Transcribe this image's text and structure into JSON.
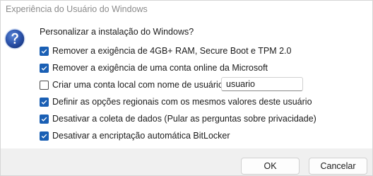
{
  "window": {
    "title": "Experiência do Usuário do Windows"
  },
  "dialog": {
    "prompt": "Personalizar a instalação do Windows?",
    "icon": "question-icon",
    "options": [
      {
        "label": "Remover a exigência de 4GB+ RAM, Secure Boot e TPM 2.0",
        "checked": true
      },
      {
        "label": "Remover a exigência de uma conta online da Microsoft",
        "checked": true
      },
      {
        "label": "Criar uma conta local com nome de usuário:",
        "checked": false
      },
      {
        "label": "Definir as opções regionais com os mesmos valores deste usuário",
        "checked": true
      },
      {
        "label": "Desativar a coleta de dados (Pular as perguntas sobre privacidade)",
        "checked": true
      },
      {
        "label": "Desativar a encriptação automática BitLocker",
        "checked": true
      }
    ],
    "username": {
      "value": "usuario"
    }
  },
  "buttons": {
    "ok_label": "OK",
    "cancel_label": "Cancelar"
  },
  "colors": {
    "accent": "#1a5fb4",
    "footer_bg": "#f0f0f0",
    "title_text": "#8a8a8a"
  }
}
